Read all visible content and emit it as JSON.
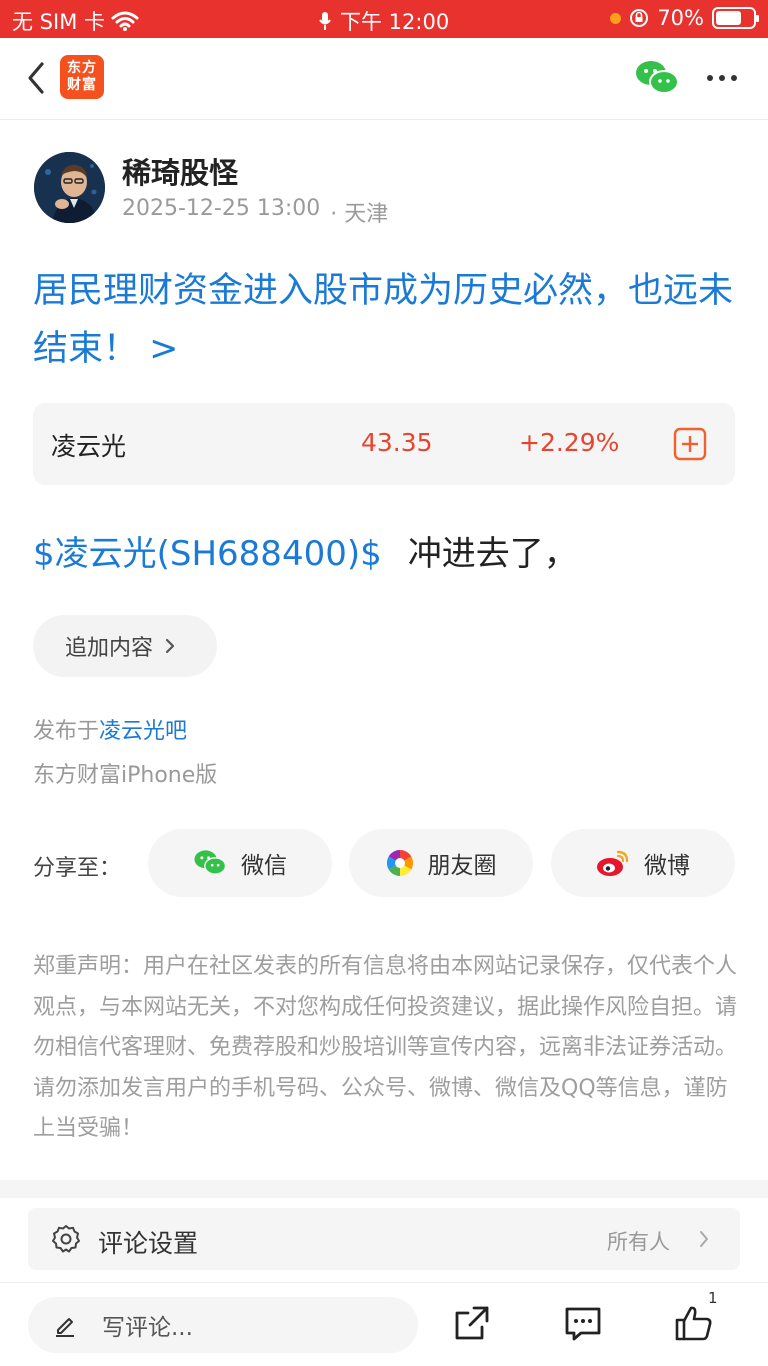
{
  "status_bar": {
    "carrier": "无 SIM 卡",
    "time": "下午 12:00",
    "battery": "70%",
    "battery_level": 0.7
  },
  "nav": {
    "logo_line1": "东方",
    "logo_line2": "财富",
    "logo_color": "#f4511e"
  },
  "author": {
    "name": "稀琦股怪",
    "datetime": "2025-12-25 13:00",
    "location": "· 天津"
  },
  "post": {
    "title": "居民理财资金进入股市成为历史必然，也远未结束！ >",
    "stock_link": "$凌云光(SH688400)$",
    "body_text": "冲进去了，"
  },
  "stock_card": {
    "name": "凌云光",
    "price": "43.35",
    "change": "+2.29%",
    "up_color": "#e6452e"
  },
  "append_button": {
    "label": "追加内容"
  },
  "source": {
    "published_prefix": "发布于",
    "bar_name": "凌云光吧",
    "device": "东方财富iPhone版"
  },
  "share": {
    "label": "分享至：",
    "options": [
      {
        "label": "微信",
        "icon": "wechat-icon"
      },
      {
        "label": "朋友圈",
        "icon": "moments-icon"
      },
      {
        "label": "微博",
        "icon": "weibo-icon"
      }
    ]
  },
  "disclaimer": "郑重声明：用户在社区发表的所有信息将由本网站记录保存，仅代表个人观点，与本网站无关，不对您构成任何投资建议，据此操作风险自担。请勿相信代客理财、免费荐股和炒股培训等宣传内容，远离非法证券活动。请勿添加发言用户的手机号码、公众号、微博、微信及QQ等信息，谨防上当受骗！",
  "comment_settings": {
    "label": "评论设置",
    "value": "所有人"
  },
  "bottom_bar": {
    "placeholder": "写评论...",
    "like_count": "1"
  },
  "colors": {
    "status_bar": "#e8322e",
    "link_blue": "#1a7ad6"
  }
}
